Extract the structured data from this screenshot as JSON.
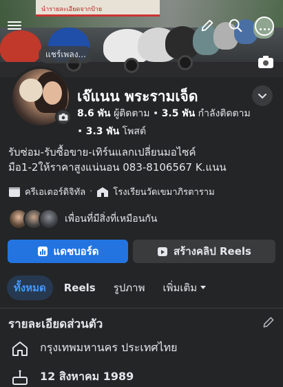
{
  "cover": {
    "sign_text": "นำรายละเอียดจากป้าย",
    "music_label": "แชร์เพลง...",
    "icons": [
      "menu-icon",
      "pencil-icon",
      "search-icon",
      "more-icon",
      "camera-icon"
    ]
  },
  "profile": {
    "name": "เจ๊แนน พระรามเจ็ด",
    "followers_count": "8.6 พัน",
    "followers_label": "ผู้ติดตาม",
    "following_count": "3.5 พัน",
    "following_label": "กำลังติดตาม",
    "posts_count": "3.3 พัน",
    "posts_label": "โพสต์",
    "bio_line1": "รับซ่อม-รับซื้อขาย-เทิร์นแลกเปลี่ยนมอไซค์",
    "bio_line2": "มือ1-2ให้ราคาสูงแน่นอน 083-8106567 K.แนน",
    "category": "ครีเอเตอร์ดิจิทัล",
    "school": "โรงเรียนวัดเขมาภิรตาราม",
    "mutual_text": "เพื่อนที่มีสิ่งที่เหมือนกัน"
  },
  "actions": {
    "dashboard_label": "แดชบอร์ด",
    "reels_create_label": "สร้างคลิป Reels"
  },
  "tabs": [
    {
      "label": "ทั้งหมด"
    },
    {
      "label": "Reels"
    },
    {
      "label": "รูปภาพ"
    },
    {
      "label": "เพิ่มเติม"
    }
  ],
  "details": {
    "title": "รายละเอียดส่วนตัว",
    "location": "กรุงเทพมหานคร ประเทศไทย",
    "birthday": "12 สิงหาคม 1989"
  },
  "colors": {
    "background": "#242526",
    "primary": "#2374e1",
    "secondary_button": "#3a3b3c",
    "active_tab_bg": "#263951",
    "active_tab_text": "#4599ff"
  }
}
